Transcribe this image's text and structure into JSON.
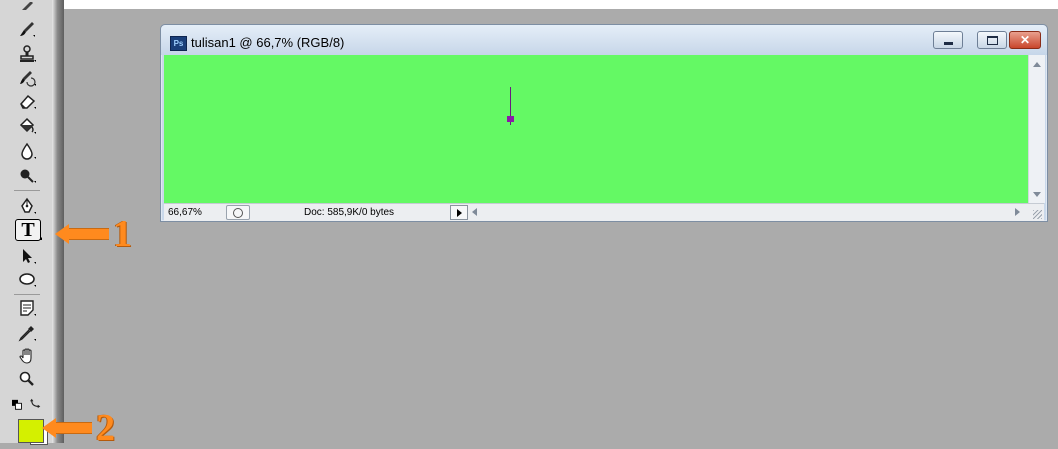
{
  "document_window": {
    "title": "tulisan1 @ 66,7% (RGB/8)",
    "app_badge": "Ps",
    "canvas_color": "#64f964",
    "status": {
      "zoom": "66,67%",
      "doc_info": "Doc: 585,9K/0 bytes"
    }
  },
  "toolbox": {
    "tools": [
      "brush-icon",
      "clone-stamp-icon",
      "history-brush-icon",
      "eraser-icon",
      "paint-bucket-icon",
      "blur-icon",
      "dodge-icon",
      "pen-icon",
      "type-icon",
      "path-selection-icon",
      "ellipse-icon",
      "notes-icon",
      "eyedropper-icon",
      "hand-icon",
      "zoom-icon",
      "default-colors-icon",
      "swap-colors-icon"
    ],
    "type_tool_glyph": "T",
    "foreground_color": "#d4f000",
    "background_color": "#ffffff"
  },
  "annotations": {
    "arrow_1_label": "1",
    "arrow_2_label": "2",
    "color": "#ff8a1e"
  },
  "workspace_color": "#ababab"
}
